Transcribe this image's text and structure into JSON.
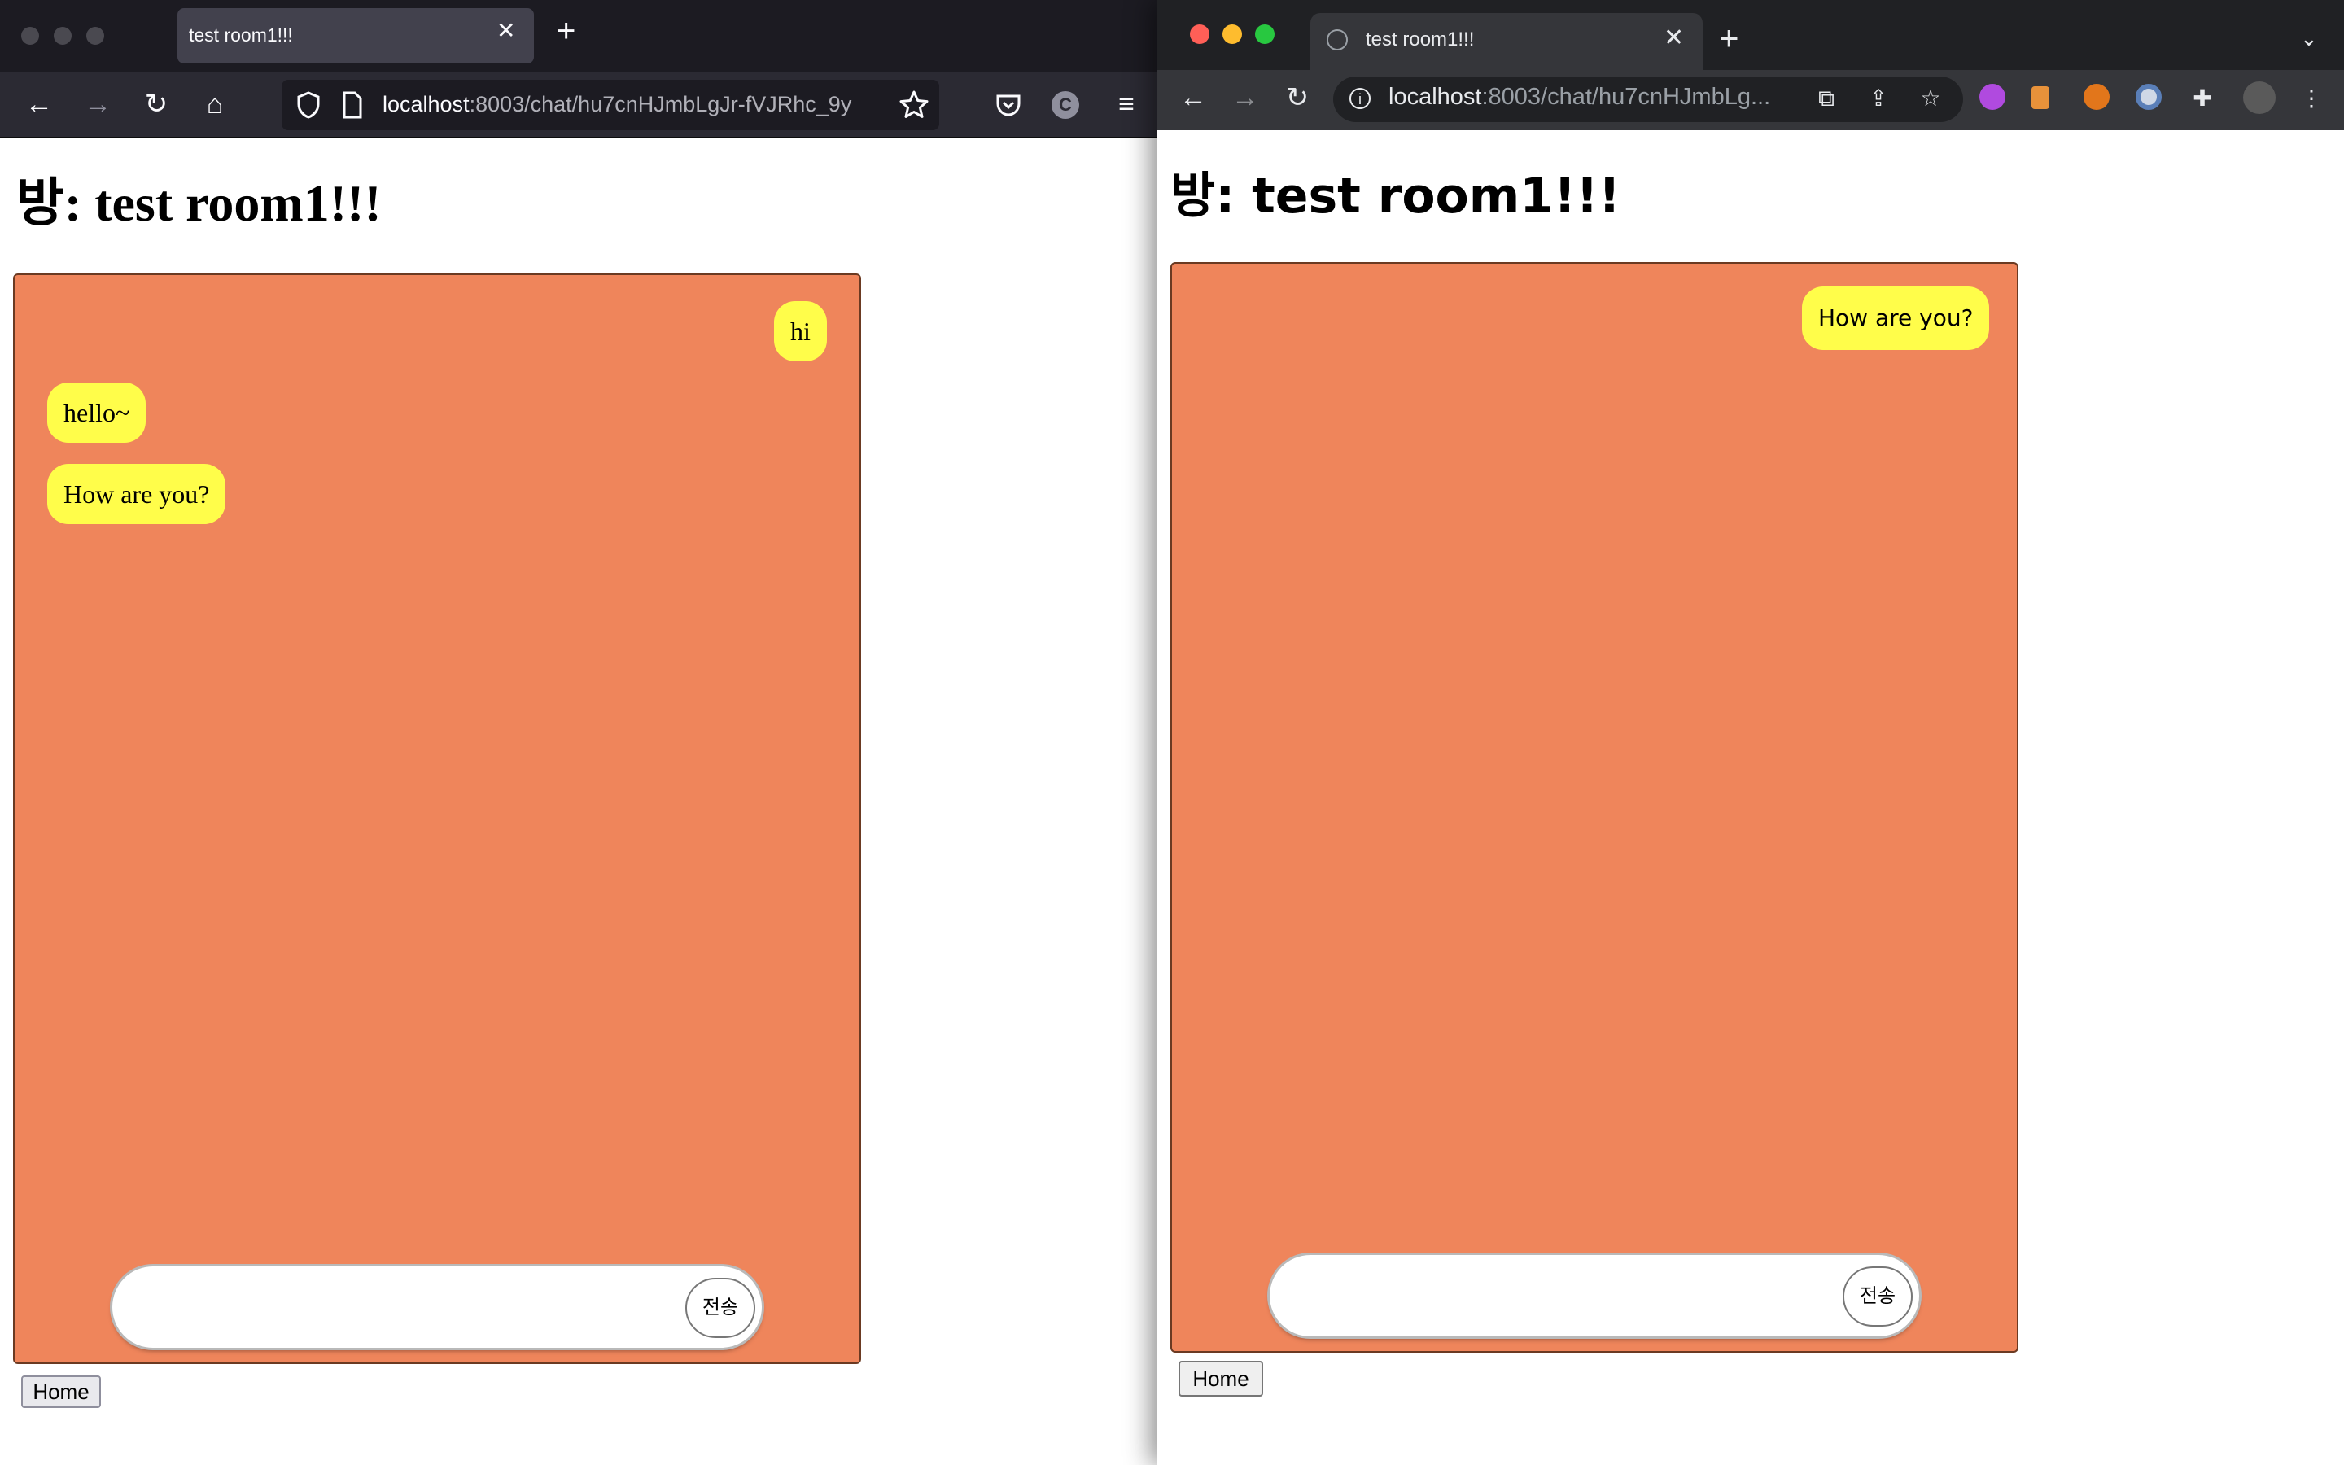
{
  "left_window": {
    "tab_title": "test room1!!!",
    "url_host": "localhost",
    "url_rest": ":8003/chat/hu7cnHJmbLgJr-fVJRhc_9y",
    "page_title": "방: test room1!!!",
    "messages": [
      {
        "text": "hi",
        "side": "right"
      },
      {
        "text": "hello~",
        "side": "left"
      },
      {
        "text": "How are you?",
        "side": "left"
      }
    ],
    "send_label": "전송",
    "home_label": "Home",
    "account_initial": "C"
  },
  "right_window": {
    "tab_title": "test room1!!!",
    "url_host": "localhost",
    "url_rest": ":8003/chat/hu7cnHJmbLg...",
    "page_title": "방: test room1!!!",
    "messages": [
      {
        "text": "How are you?",
        "side": "right"
      }
    ],
    "send_label": "전송",
    "home_label": "Home"
  },
  "colors": {
    "chat_background": "#ef855b",
    "bubble": "#fffd4a",
    "traffic_red": "#ff5f57",
    "traffic_yellow": "#febc2e",
    "traffic_green": "#28c840"
  }
}
